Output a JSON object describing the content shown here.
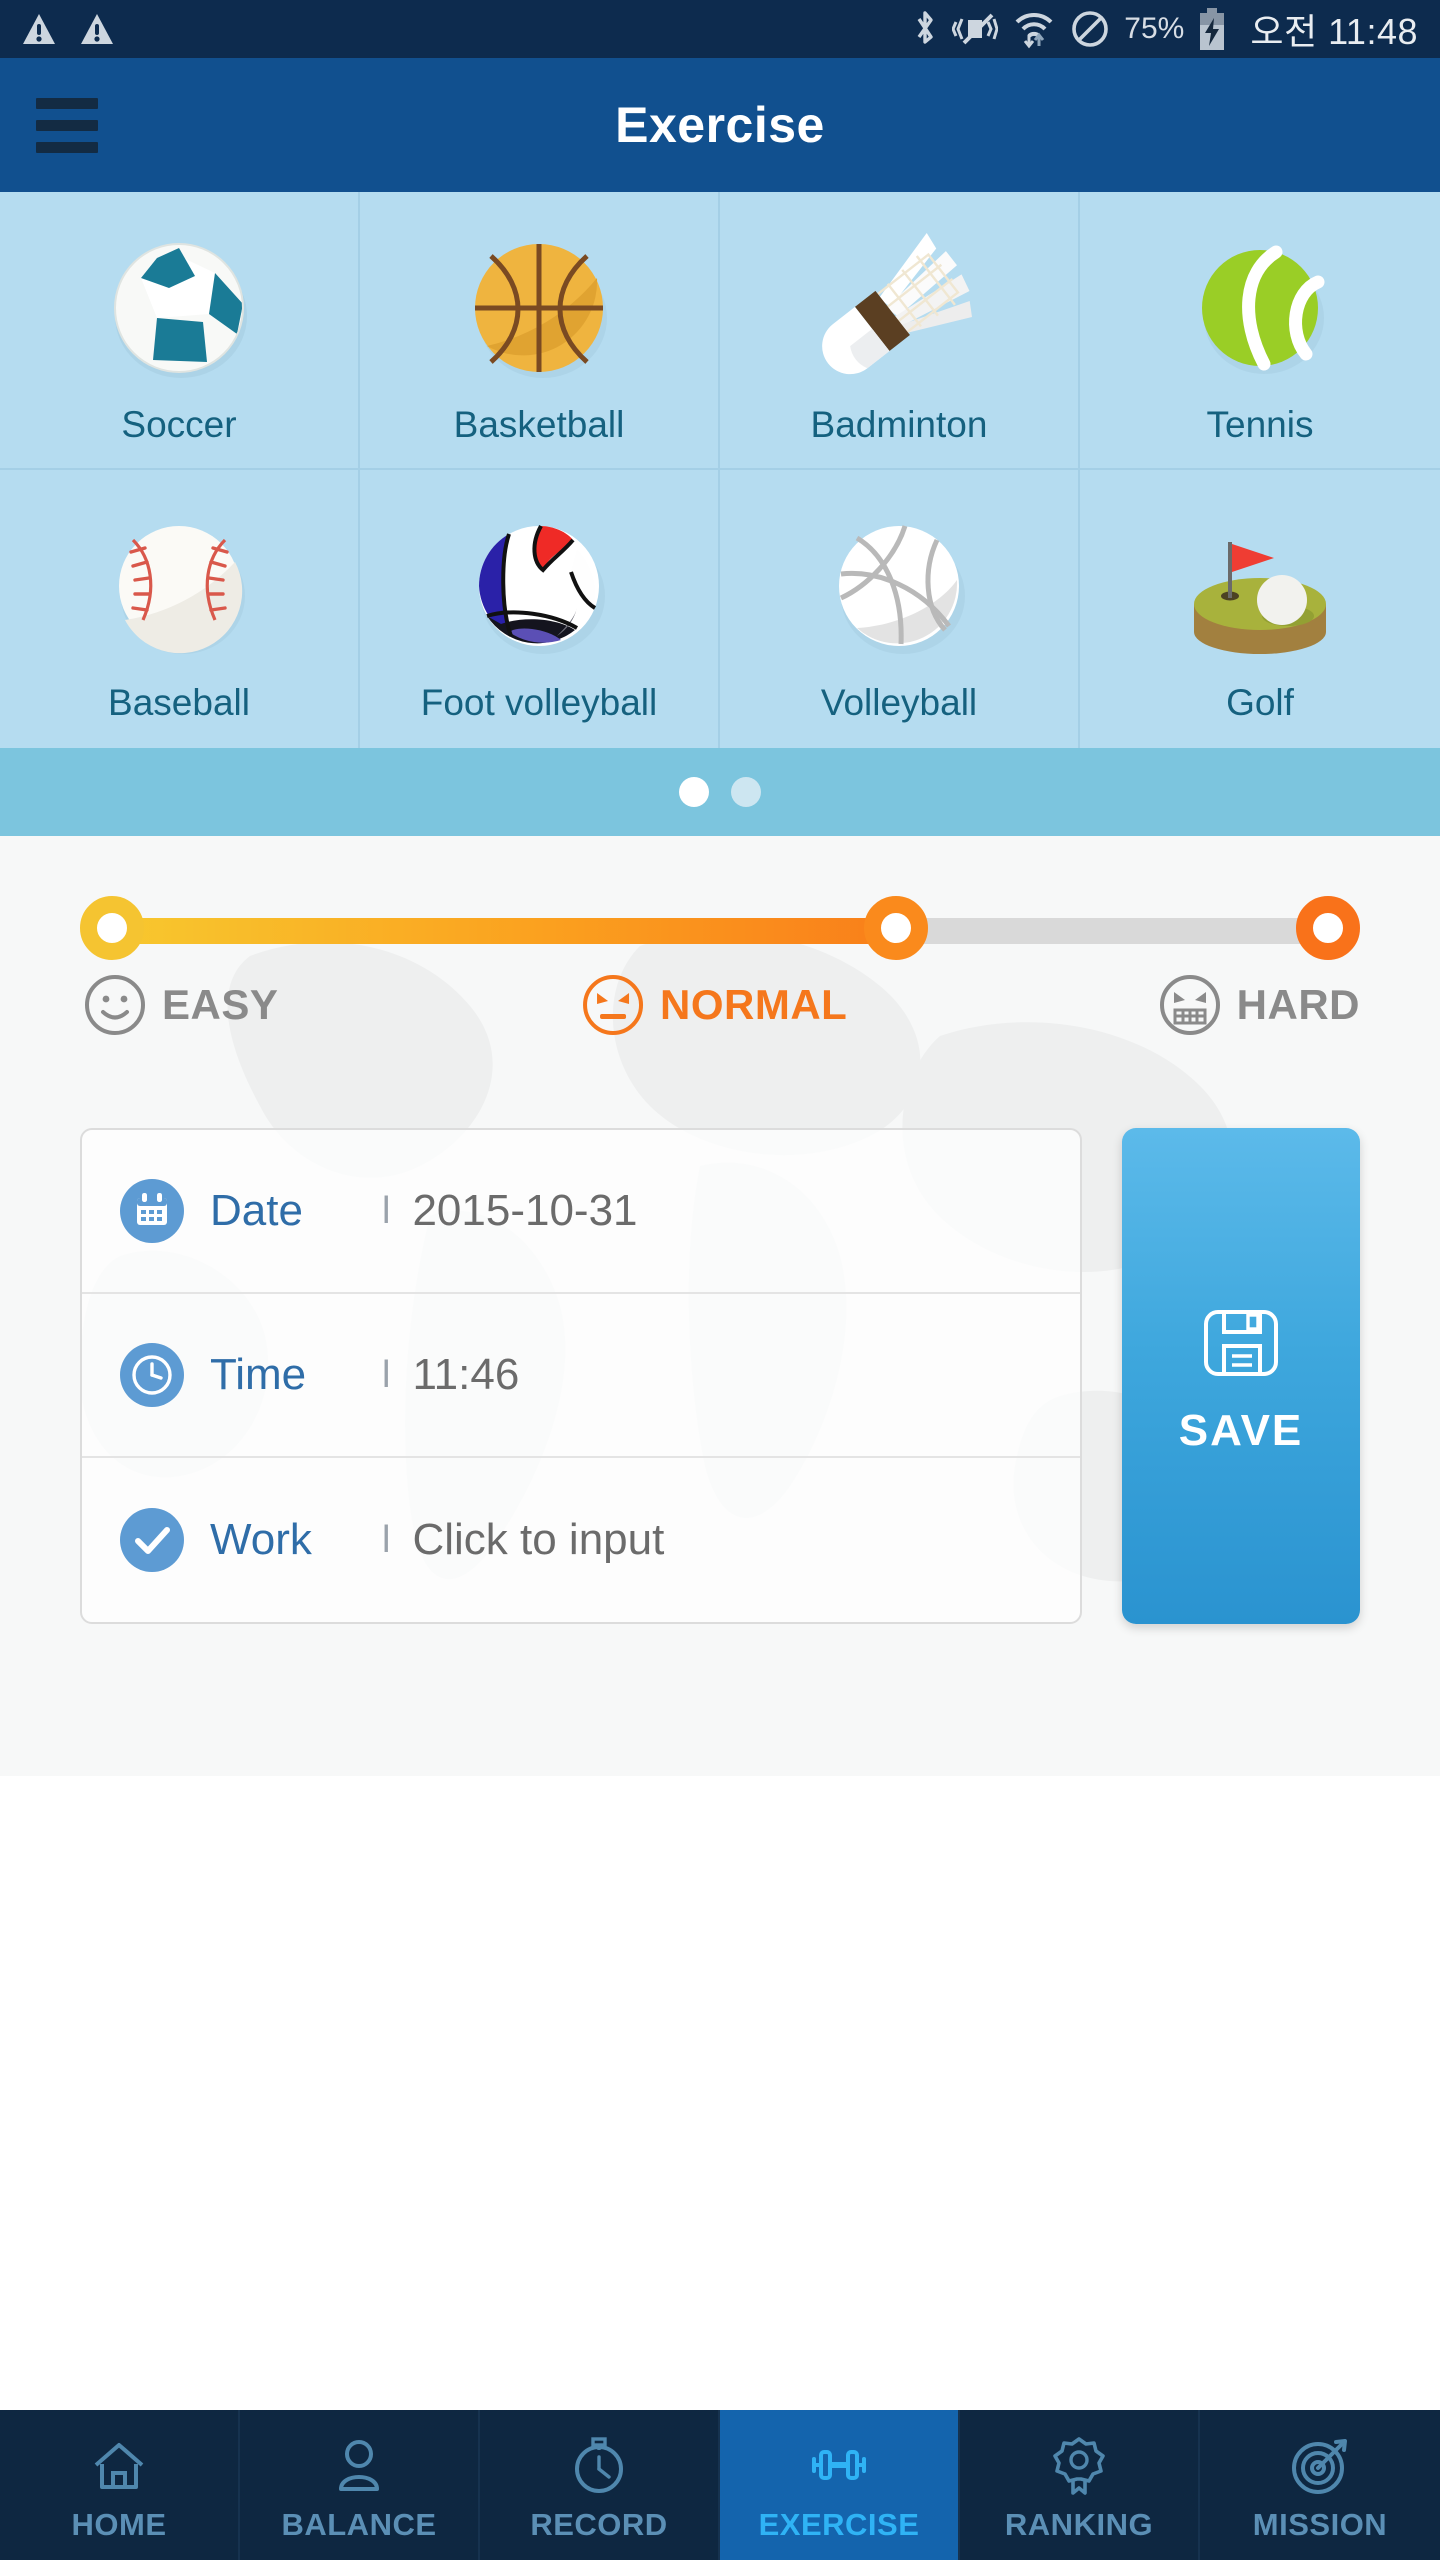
{
  "status_bar": {
    "icons": [
      "warning-triangle-icon",
      "warning-triangle-icon",
      "bluetooth-icon",
      "vibrate-off-icon",
      "wifi-data-icon",
      "do-not-disturb-icon"
    ],
    "battery_percent": "75%",
    "battery_state": "charging",
    "clock": "오전 11:48",
    "background_color": "#0d2b4e"
  },
  "app_bar": {
    "menu_icon": "hamburger-menu-icon",
    "title": "Exercise",
    "background_color": "#11508f"
  },
  "sports": {
    "background_color": "#b5dcf0",
    "items": [
      {
        "label": "Soccer",
        "icon": "soccer-ball-icon"
      },
      {
        "label": "Basketball",
        "icon": "basketball-icon"
      },
      {
        "label": "Badminton",
        "icon": "shuttlecock-icon"
      },
      {
        "label": "Tennis",
        "icon": "tennis-ball-icon"
      },
      {
        "label": "Baseball",
        "icon": "baseball-icon"
      },
      {
        "label": "Foot volleyball",
        "icon": "foot-volleyball-icon"
      },
      {
        "label": "Volleyball",
        "icon": "volleyball-icon"
      },
      {
        "label": "Golf",
        "icon": "golf-green-icon"
      }
    ]
  },
  "pager": {
    "total": 2,
    "active_index": 0,
    "background_color": "#7cc5de"
  },
  "difficulty": {
    "selected": "NORMAL",
    "selected_color": "#f5771c",
    "levels": [
      {
        "label": "EASY",
        "icon": "smiley-face-icon",
        "selected": false
      },
      {
        "label": "NORMAL",
        "icon": "angry-face-icon",
        "selected": true
      },
      {
        "label": "HARD",
        "icon": "gritted-teeth-face-icon",
        "selected": false
      }
    ]
  },
  "form": {
    "rows": [
      {
        "label": "Date",
        "icon": "calendar-icon",
        "separator": "l",
        "value": "2015-10-31"
      },
      {
        "label": "Time",
        "icon": "clock-icon",
        "separator": "l",
        "value": "11:46"
      },
      {
        "label": "Work",
        "icon": "check-circle-icon",
        "separator": "l",
        "value": "Click to input"
      }
    ]
  },
  "save_button": {
    "icon": "floppy-disk-icon",
    "label": "SAVE",
    "color": "#3ea7dd"
  },
  "bottom_nav": {
    "active_index": 3,
    "active_color": "#2fb3f5",
    "items": [
      {
        "label": "HOME",
        "icon": "house-icon"
      },
      {
        "label": "BALANCE",
        "icon": "person-icon"
      },
      {
        "label": "RECORD",
        "icon": "stopwatch-icon"
      },
      {
        "label": "EXERCISE",
        "icon": "dumbbell-icon"
      },
      {
        "label": "RANKING",
        "icon": "medal-ribbon-icon"
      },
      {
        "label": "MISSION",
        "icon": "target-arrow-icon"
      }
    ]
  }
}
